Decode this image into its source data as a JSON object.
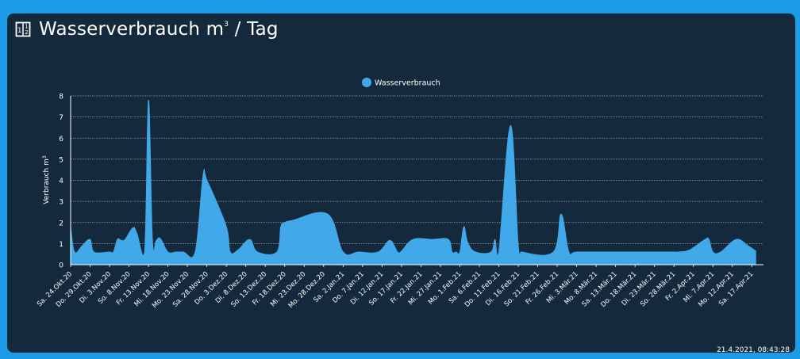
{
  "card": {
    "title": "Wasserverbrauch",
    "title_unit_base": "m",
    "title_unit_sup": "3",
    "title_suffix": " / Tag",
    "icon": "calculator-icon",
    "timestamp": "21.4.2021, 08:43:28"
  },
  "colors": {
    "page_bg": "#1e9be6",
    "card_bg": "#14293b",
    "series": "#41a8ea",
    "grid": "#bfc6cf",
    "text": "#ffffff"
  },
  "chart_data": {
    "type": "area",
    "legend": {
      "position": "top-center",
      "entries": [
        "Wasserverbrauch"
      ]
    },
    "ylabel_base": "Verbrauch m",
    "ylabel_sup": "3",
    "ylim": [
      0,
      8
    ],
    "yticks": [
      0,
      1,
      2,
      3,
      4,
      5,
      6,
      7,
      8
    ],
    "grid": true,
    "x_range": [
      "2020-10-24",
      "2021-04-20"
    ],
    "xtick_labels": [
      {
        "date": "2020-10-24",
        "label": "Sa. 24.Okt.20"
      },
      {
        "date": "2020-10-29",
        "label": "Do. 29.Okt.20"
      },
      {
        "date": "2020-11-03",
        "label": "Di. 3.Nov.20"
      },
      {
        "date": "2020-11-08",
        "label": "So. 8.Nov.20"
      },
      {
        "date": "2020-11-13",
        "label": "Fr. 13.Nov.20"
      },
      {
        "date": "2020-11-18",
        "label": "Mi. 18.Nov.20"
      },
      {
        "date": "2020-11-23",
        "label": "Mo. 23.Nov.20"
      },
      {
        "date": "2020-11-28",
        "label": "Sa. 28.Nov.20"
      },
      {
        "date": "2020-12-03",
        "label": "Do. 3.Dez.20"
      },
      {
        "date": "2020-12-08",
        "label": "Di. 8.Dez.20"
      },
      {
        "date": "2020-12-13",
        "label": "So. 13.Dez.20"
      },
      {
        "date": "2020-12-18",
        "label": "Fr. 18.Dez.20"
      },
      {
        "date": "2020-12-23",
        "label": "Mi. 23.Dez.20"
      },
      {
        "date": "2020-12-28",
        "label": "Mo. 28.Dez.20"
      },
      {
        "date": "2021-01-02",
        "label": "Sa. 2.Jan.21"
      },
      {
        "date": "2021-01-07",
        "label": "Do. 7.Jan.21"
      },
      {
        "date": "2021-01-12",
        "label": "Di. 12.Jan.21"
      },
      {
        "date": "2021-01-17",
        "label": "So. 17.Jan.21"
      },
      {
        "date": "2021-01-22",
        "label": "Fr. 22.Jan.21"
      },
      {
        "date": "2021-01-27",
        "label": "Mi. 27.Jan.21"
      },
      {
        "date": "2021-02-01",
        "label": "Mo. 1.Feb.21"
      },
      {
        "date": "2021-02-06",
        "label": "Sa. 6.Feb.21"
      },
      {
        "date": "2021-02-11",
        "label": "Do. 11.Feb.21"
      },
      {
        "date": "2021-02-16",
        "label": "Di. 16.Feb.21"
      },
      {
        "date": "2021-02-21",
        "label": "So. 21.Feb.21"
      },
      {
        "date": "2021-02-26",
        "label": "Fr. 26.Feb.21"
      },
      {
        "date": "2021-03-03",
        "label": "Mi. 3.Mär.21"
      },
      {
        "date": "2021-03-08",
        "label": "Mo. 8.Mär.21"
      },
      {
        "date": "2021-03-13",
        "label": "Sa. 13.Mär.21"
      },
      {
        "date": "2021-03-18",
        "label": "Do. 18.Mär.21"
      },
      {
        "date": "2021-03-23",
        "label": "Di. 23.Mär.21"
      },
      {
        "date": "2021-03-28",
        "label": "So. 28.Mär.21"
      },
      {
        "date": "2021-04-02",
        "label": "Fr. 2.Apr.21"
      },
      {
        "date": "2021-04-07",
        "label": "Mi. 7.Apr.21"
      },
      {
        "date": "2021-04-12",
        "label": "Mo. 12.Apr.21"
      },
      {
        "date": "2021-04-17",
        "label": "Sa. 17.Apr.21"
      }
    ],
    "series": [
      {
        "name": "Wasserverbrauch",
        "points": [
          [
            "2020-10-24",
            1.8
          ],
          [
            "2020-10-25",
            0.6
          ],
          [
            "2020-10-27",
            0.9
          ],
          [
            "2020-10-29",
            1.2
          ],
          [
            "2020-10-30",
            0.6
          ],
          [
            "2020-11-03",
            0.6
          ],
          [
            "2020-11-04",
            0.6
          ],
          [
            "2020-11-05",
            1.2
          ],
          [
            "2020-11-06",
            1.15
          ],
          [
            "2020-11-07",
            1.2
          ],
          [
            "2020-11-09",
            1.75
          ],
          [
            "2020-11-10",
            1.5
          ],
          [
            "2020-11-12",
            0.6
          ],
          [
            "2020-11-13",
            7.8
          ],
          [
            "2020-11-14",
            1.2
          ],
          [
            "2020-11-15",
            1.15
          ],
          [
            "2020-11-16",
            1.25
          ],
          [
            "2020-11-18",
            0.6
          ],
          [
            "2020-11-20",
            0.6
          ],
          [
            "2020-11-22",
            0.6
          ],
          [
            "2020-11-25",
            0.6
          ],
          [
            "2020-11-27",
            4.2
          ],
          [
            "2020-11-28",
            4.0
          ],
          [
            "2020-12-03",
            1.8
          ],
          [
            "2020-12-04",
            0.6
          ],
          [
            "2020-12-06",
            0.7
          ],
          [
            "2020-12-09",
            1.2
          ],
          [
            "2020-12-11",
            0.6
          ],
          [
            "2020-12-16",
            0.6
          ],
          [
            "2020-12-17",
            1.8
          ],
          [
            "2020-12-18",
            2.0
          ],
          [
            "2020-12-20",
            2.1
          ],
          [
            "2020-12-29",
            2.4
          ],
          [
            "2021-01-02",
            0.6
          ],
          [
            "2021-01-06",
            0.6
          ],
          [
            "2021-01-11",
            0.6
          ],
          [
            "2021-01-14",
            1.15
          ],
          [
            "2021-01-16",
            0.6
          ],
          [
            "2021-01-17",
            0.65
          ],
          [
            "2021-01-20",
            1.2
          ],
          [
            "2021-01-25",
            1.2
          ],
          [
            "2021-01-29",
            1.2
          ],
          [
            "2021-01-30",
            0.6
          ],
          [
            "2021-01-31",
            0.6
          ],
          [
            "2021-02-01",
            0.6
          ],
          [
            "2021-02-02",
            1.8
          ],
          [
            "2021-02-03",
            1.05
          ],
          [
            "2021-02-05",
            0.6
          ],
          [
            "2021-02-09",
            0.6
          ],
          [
            "2021-02-10",
            1.2
          ],
          [
            "2021-02-11",
            0.6
          ],
          [
            "2021-02-14",
            6.6
          ],
          [
            "2021-02-16",
            0.9
          ],
          [
            "2021-02-17",
            0.6
          ],
          [
            "2021-02-25",
            0.6
          ],
          [
            "2021-02-27",
            2.4
          ],
          [
            "2021-03-01",
            0.6
          ],
          [
            "2021-03-03",
            0.6
          ],
          [
            "2021-03-28",
            0.6
          ],
          [
            "2021-03-29",
            0.6
          ],
          [
            "2021-04-01",
            0.7
          ],
          [
            "2021-04-05",
            1.2
          ],
          [
            "2021-04-06",
            1.2
          ],
          [
            "2021-04-07",
            0.6
          ],
          [
            "2021-04-09",
            0.6
          ],
          [
            "2021-04-13",
            1.2
          ],
          [
            "2021-04-16",
            0.9
          ],
          [
            "2021-04-18",
            0.65
          ]
        ]
      }
    ]
  }
}
